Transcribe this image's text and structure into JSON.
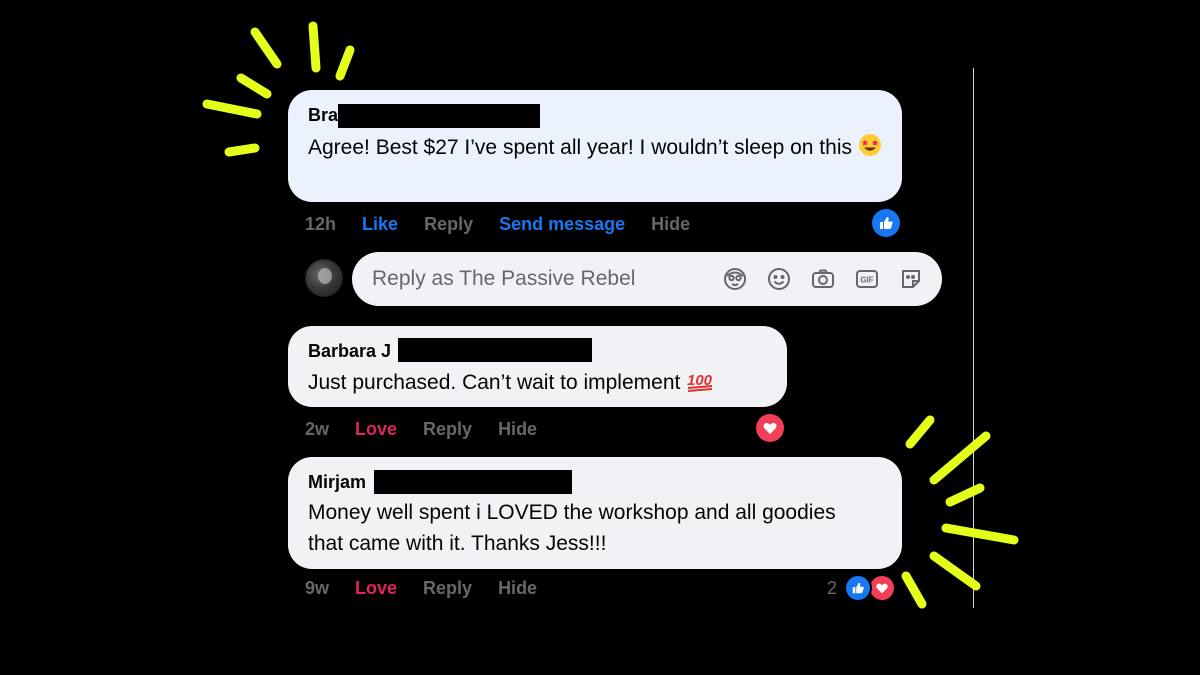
{
  "colors": {
    "background": "#000000",
    "accent_lime": "#e4ff1a",
    "facebook_blue": "#1877f2",
    "love_red": "#e0245e",
    "bubble_highlight": "#ebf2fe",
    "bubble_plain": "#f0f2f5",
    "meta_gray": "#65676b"
  },
  "comments": [
    {
      "author": "Bra",
      "text": "Agree! Best $27 I’ve spent all year! I wouldn’t sleep on this",
      "emoji_icon": "star-struck-emoji",
      "time": "12h",
      "reaction_label": "Like",
      "reply_label": "Reply",
      "send_message_label": "Send message",
      "hide_label": "Hide",
      "reactions": [
        "like-icon"
      ]
    },
    {
      "author": "Barbara J",
      "text": "Just purchased. Can’t wait to implement",
      "emoji_icon": "hundred-points-emoji",
      "time": "2w",
      "reaction_label": "Love",
      "reply_label": "Reply",
      "hide_label": "Hide",
      "reactions": [
        "love-icon"
      ]
    },
    {
      "author": "Mirjam",
      "text": "Money well spent i LOVED the workshop and all goodies that came with it. Thanks Jess!!!",
      "time": "9w",
      "reaction_label": "Love",
      "reply_label": "Reply",
      "hide_label": "Hide",
      "reaction_count": "2",
      "reactions": [
        "like-icon",
        "love-icon"
      ]
    }
  ],
  "reply_box": {
    "placeholder": "Reply as The Passive Rebel",
    "tools": [
      "avatar-sticker-icon",
      "smiley-icon",
      "camera-icon",
      "gif-icon",
      "sticker-icon"
    ]
  }
}
